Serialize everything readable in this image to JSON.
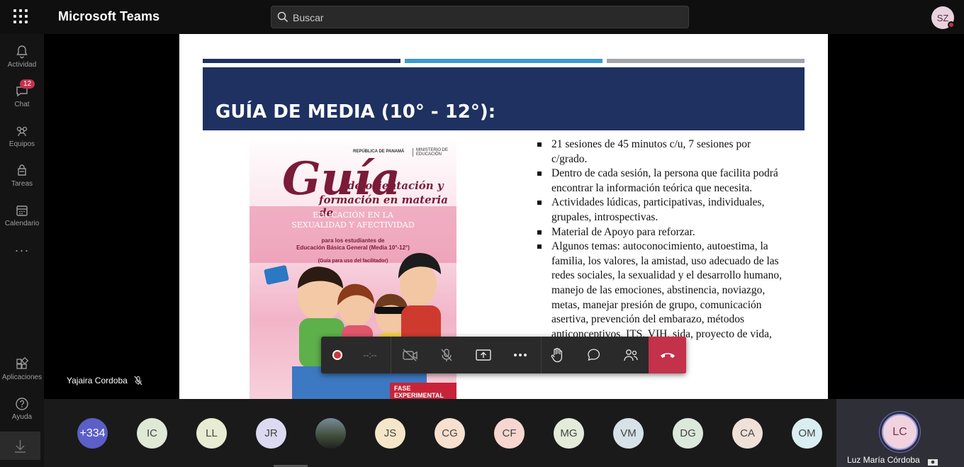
{
  "app": {
    "title": "Microsoft Teams"
  },
  "search": {
    "placeholder": "Buscar"
  },
  "user": {
    "initials": "SZ"
  },
  "rail": {
    "items": [
      {
        "label": "Actividad",
        "icon": "bell-icon"
      },
      {
        "label": "Chat",
        "icon": "chat-icon",
        "badge": "12"
      },
      {
        "label": "Equipos",
        "icon": "teams-icon"
      },
      {
        "label": "Tareas",
        "icon": "assignments-icon"
      },
      {
        "label": "Calendario",
        "icon": "calendar-icon"
      }
    ],
    "more": "···",
    "bottom": [
      {
        "label": "Aplicaciones",
        "icon": "apps-icon"
      },
      {
        "label": "Ayuda",
        "icon": "help-icon"
      }
    ]
  },
  "slide": {
    "title": "GUÍA DE MEDIA (10° - 12°):",
    "bar_colors": [
      "#1e3160",
      "#3a9bd1",
      "#a0a4ab"
    ],
    "cover": {
      "logo_left": "REPÚBLICA DE PANAMÁ",
      "logo_right": "MINISTERIO DE EDUCACIÓN",
      "word": "Guía",
      "line1": "de orientación y",
      "line2": "formación en materia de",
      "line3": "EDUCACIÓN EN LA",
      "line4": "SEXUALIDAD Y AFECTIVIDAD",
      "line5": "para los estudiantes de",
      "line6": "Educación Básica General (Media 10°-12°)",
      "line7": "(Guía para uso del facilitador)",
      "badge": "FASE EXPERIMENTAL"
    },
    "bullets": [
      "21 sesiones de 45 minutos c/u, 7 sesiones por c/grado.",
      "Dentro de cada sesión, la persona que facilita podrá encontrar la información teórica que necesita.",
      "Actividades lúdicas, participativas, individuales, grupales, introspectivas.",
      "Material de Apoyo para reforzar.",
      "Algunos temas: autoconocimiento, autoestima, la familia, los valores, la amistad, uso adecuado de las redes sociales, la sexualidad y el desarrollo humano,  manejo de las emociones, abstinencia, noviazgo, metas, manejar presión de grupo, comunicación asertiva, prevención del embarazo, métodos anticonceptivos, ITS, VIH, sida, proyecto de vida, prevención de drogas."
    ]
  },
  "presenter": {
    "name": "Yajaira Cordoba"
  },
  "toolbar": {
    "timer": "--:--"
  },
  "participants": {
    "overflow": "+334",
    "list": [
      {
        "initials": "IC",
        "color": "#dfe9d6"
      },
      {
        "initials": "LL",
        "color": "#e7ecd2"
      },
      {
        "initials": "JR",
        "color": "#dcdaf0"
      },
      {
        "initials": "",
        "color": "#556070",
        "photo": true
      },
      {
        "initials": "JS",
        "color": "#f6e6c9"
      },
      {
        "initials": "CG",
        "color": "#f8e0cf"
      },
      {
        "initials": "CF",
        "color": "#f6d6cf"
      },
      {
        "initials": "MG",
        "color": "#e4ecd9"
      },
      {
        "initials": "VM",
        "color": "#d6e2e8"
      },
      {
        "initials": "DG",
        "color": "#dde8dc"
      },
      {
        "initials": "CA",
        "color": "#efe0d8"
      },
      {
        "initials": "OM",
        "color": "#d9eef0"
      }
    ],
    "me": {
      "initials": "LC",
      "name": "Luz María Córdoba"
    }
  }
}
